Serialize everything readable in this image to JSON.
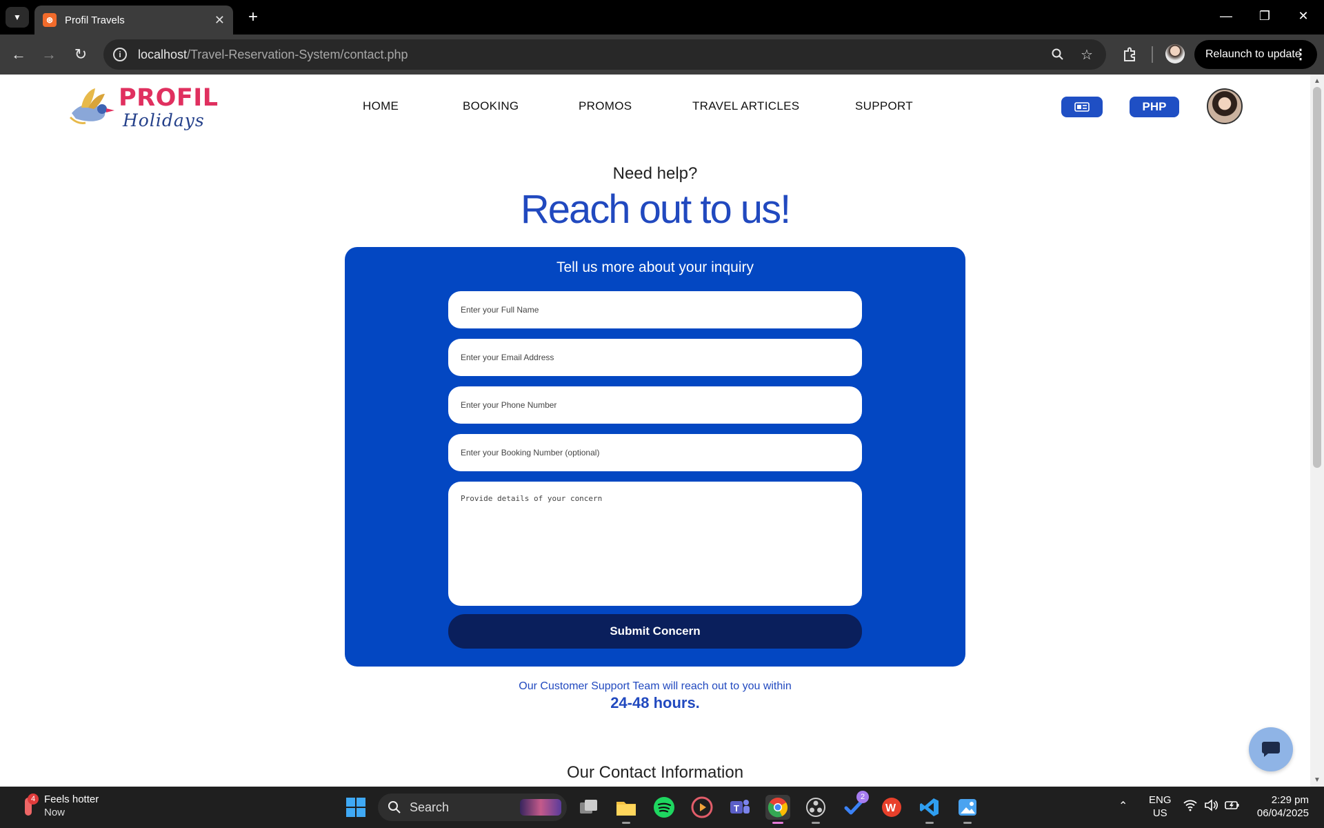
{
  "browser": {
    "tab_title": "Profil Travels",
    "url_host": "localhost",
    "url_path": "/Travel-Reservation-System/contact.php",
    "relaunch_label": "Relaunch to update"
  },
  "site": {
    "logo_brand": "PROFIL",
    "logo_tagline": "Holidays",
    "nav": [
      "HOME",
      "BOOKING",
      "PROMOS",
      "TRAVEL ARTICLES",
      "SUPPORT"
    ],
    "currency_label": "PHP"
  },
  "hero": {
    "kicker": "Need help?",
    "headline": "Reach out to us!"
  },
  "form": {
    "title": "Tell us more about your inquiry",
    "full_name_placeholder": "Enter your Full Name",
    "email_placeholder": "Enter your Email Address",
    "phone_placeholder": "Enter your Phone Number",
    "booking_placeholder": "Enter your Booking Number (optional)",
    "concern_placeholder": "Provide details of your concern",
    "submit_label": "Submit Concern"
  },
  "support": {
    "line": "Our Customer Support Team will reach out to you within",
    "hours": "24-48 hours."
  },
  "contact_heading": "Our Contact Information",
  "taskbar": {
    "weather_title": "Feels hotter",
    "weather_sub": "Now",
    "weather_badge": "4",
    "search_label": "Search",
    "todo_badge": "2",
    "lang_line1": "ENG",
    "lang_line2": "US",
    "time": "2:29 pm",
    "date": "06/04/2025"
  },
  "colors": {
    "brand_blue": "#0347c2",
    "headline_blue": "#2149bf",
    "submit_navy": "#0a1f5c",
    "logo_pink": "#e0305f"
  }
}
